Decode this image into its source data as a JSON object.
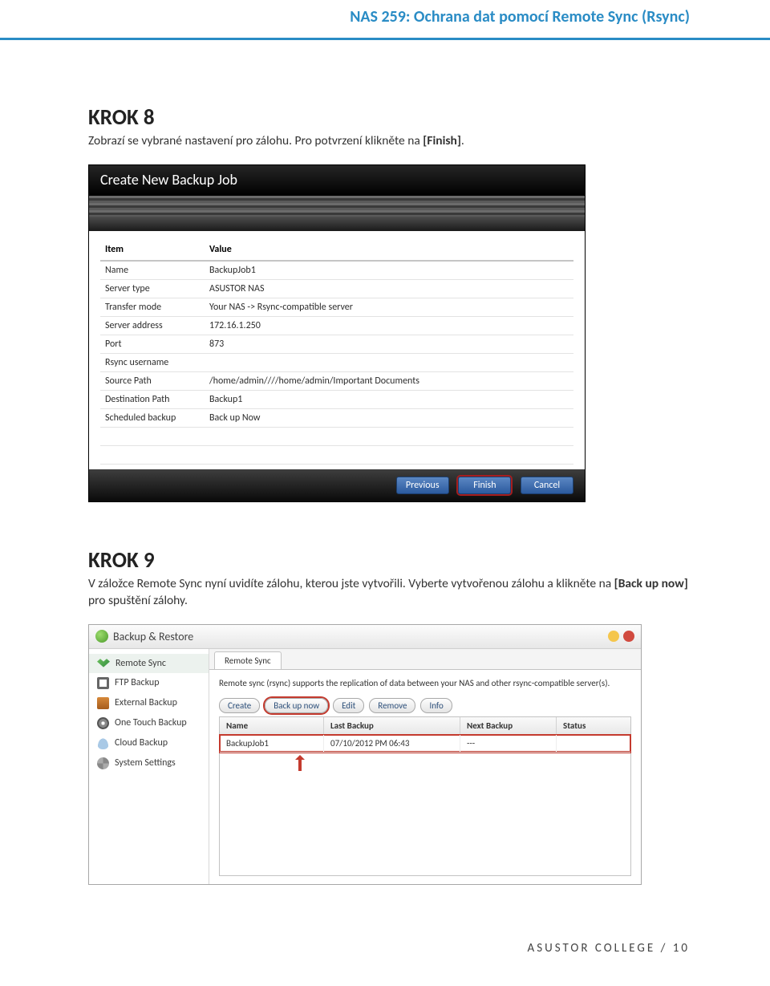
{
  "doc": {
    "header_title": "NAS 259: Ochrana dat pomocí Remote Sync (Rsync)",
    "step8_head": "KROK 8",
    "step8_text_a": "Zobrazí se vybrané nastavení pro zálohu. Pro potvrzení klikněte na ",
    "step8_text_b": "[Finish]",
    "step8_text_c": ".",
    "step9_head": "KROK 9",
    "step9_text_a": "V záložce Remote Sync nyní uvidíte zálohu, kterou jste vytvořili. Vyberte vytvořenou zálohu a klikněte na ",
    "step9_text_b": "[Back up now]",
    "step9_text_c": " pro spuštění zálohy.",
    "footer": "ASUSTOR COLLEGE / 10"
  },
  "dialog1": {
    "title": "Create New Backup Job",
    "col_item": "Item",
    "col_value": "Value",
    "rows": [
      {
        "item": "Name",
        "value": "BackupJob1"
      },
      {
        "item": "Server type",
        "value": "ASUSTOR NAS"
      },
      {
        "item": "Transfer mode",
        "value": "Your NAS -> Rsync-compatible server"
      },
      {
        "item": "Server address",
        "value": "172.16.1.250"
      },
      {
        "item": "Port",
        "value": "873"
      },
      {
        "item": "Rsync username",
        "value": ""
      },
      {
        "item": "Source Path",
        "value": "/home/admin////home/admin/Important Documents"
      },
      {
        "item": "Destination Path",
        "value": "Backup1"
      },
      {
        "item": "Scheduled backup",
        "value": "Back up Now"
      }
    ],
    "btn_prev": "Previous",
    "btn_finish": "Finish",
    "btn_cancel": "Cancel"
  },
  "win2": {
    "app_title": "Backup & Restore",
    "side": [
      "Remote Sync",
      "FTP Backup",
      "External Backup",
      "One Touch Backup",
      "Cloud Backup",
      "System Settings"
    ],
    "tab": "Remote Sync",
    "desc": "Remote sync (rsync) supports the replication of data between your NAS and other rsync-compatible server(s).",
    "btn_create": "Create",
    "btn_backup": "Back up now",
    "btn_edit": "Edit",
    "btn_remove": "Remove",
    "btn_info": "Info",
    "col_name": "Name",
    "col_last": "Last Backup",
    "col_next": "Next Backup",
    "col_status": "Status",
    "row": {
      "name": "BackupJob1",
      "last": "07/10/2012 PM 06:43",
      "next": "---",
      "status": ""
    }
  }
}
